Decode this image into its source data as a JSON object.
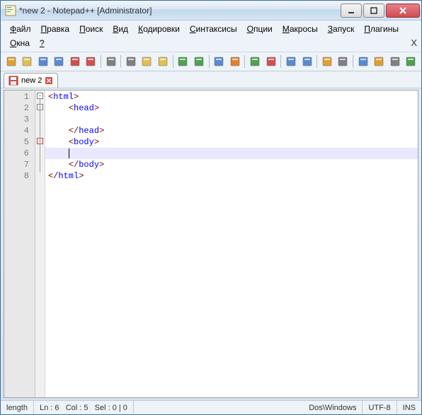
{
  "window": {
    "title": "*new 2 - Notepad++ [Administrator]"
  },
  "menubar": {
    "file": "Файл",
    "edit": "Правка",
    "search": "Поиск",
    "view": "Вид",
    "encoding": "Кодировки",
    "language": "Синтаксисы",
    "settings": "Опции",
    "macro": "Макросы",
    "run": "Запуск",
    "plugins": "Плагины",
    "window": "Окна",
    "help": "?",
    "x": "X"
  },
  "tab": {
    "name": "new 2"
  },
  "code_lines": [
    {
      "tag": "html",
      "kind": "open",
      "indent": ""
    },
    {
      "tag": "head",
      "kind": "open",
      "indent": "    "
    },
    {
      "tag": "",
      "kind": "blank",
      "indent": ""
    },
    {
      "tag": "head",
      "kind": "close",
      "indent": "    "
    },
    {
      "tag": "body",
      "kind": "open",
      "indent": "    "
    },
    {
      "tag": "",
      "kind": "caret",
      "indent": "    "
    },
    {
      "tag": "body",
      "kind": "close",
      "indent": "    "
    },
    {
      "tag": "html",
      "kind": "close",
      "indent": ""
    }
  ],
  "line_numbers": [
    "1",
    "2",
    "3",
    "4",
    "5",
    "6",
    "7",
    "8"
  ],
  "status": {
    "length": "length",
    "ln": "Ln : 6",
    "col": "Col : 5",
    "sel": "Sel : 0 | 0",
    "eol": "Dos\\Windows",
    "enc": "UTF-8",
    "mode": "INS"
  },
  "toolbar_icons": [
    {
      "name": "new-file-icon",
      "color": "#e0a030"
    },
    {
      "name": "open-file-icon",
      "color": "#e0c050"
    },
    {
      "name": "save-icon",
      "color": "#5a8ad0"
    },
    {
      "name": "save-all-icon",
      "color": "#5a8ad0"
    },
    {
      "name": "close-icon",
      "color": "#d05050"
    },
    {
      "name": "close-all-icon",
      "color": "#d05050"
    },
    {
      "name": "print-icon",
      "color": "#808080"
    },
    {
      "name": "cut-icon",
      "color": "#808080"
    },
    {
      "name": "copy-icon",
      "color": "#e0c050"
    },
    {
      "name": "paste-icon",
      "color": "#e0c050"
    },
    {
      "name": "undo-icon",
      "color": "#50a050"
    },
    {
      "name": "redo-icon",
      "color": "#50a050"
    },
    {
      "name": "find-icon",
      "color": "#5a8ad0"
    },
    {
      "name": "replace-icon",
      "color": "#e08030"
    },
    {
      "name": "zoom-in-icon",
      "color": "#50a050"
    },
    {
      "name": "zoom-out-icon",
      "color": "#d05050"
    },
    {
      "name": "sync-v-icon",
      "color": "#5a8ad0"
    },
    {
      "name": "sync-h-icon",
      "color": "#5a8ad0"
    },
    {
      "name": "wordwrap-icon",
      "color": "#e0a030"
    },
    {
      "name": "all-chars-icon",
      "color": "#808080"
    },
    {
      "name": "indent-guide-icon",
      "color": "#5a8ad0"
    },
    {
      "name": "doc-map-icon",
      "color": "#e0a030"
    },
    {
      "name": "func-list-icon",
      "color": "#808080"
    },
    {
      "name": "folder-tree-icon",
      "color": "#50a050"
    }
  ]
}
